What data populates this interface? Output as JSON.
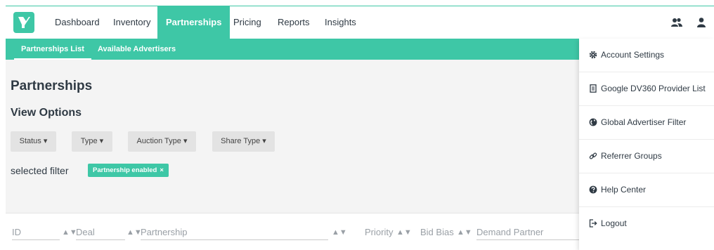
{
  "nav": {
    "items": [
      {
        "label": "Dashboard",
        "active": false
      },
      {
        "label": "Inventory",
        "active": false
      },
      {
        "label": "Partnerships",
        "active": true
      },
      {
        "label": "Pricing",
        "active": false
      },
      {
        "label": "Reports",
        "active": false
      },
      {
        "label": "Insights",
        "active": false
      }
    ],
    "icons": [
      "users-icon",
      "user-icon"
    ]
  },
  "subnav": {
    "items": [
      {
        "label": "Partnerships List",
        "active": true
      },
      {
        "label": "Available Advertisers",
        "active": false
      }
    ]
  },
  "main": {
    "title": "Partnerships",
    "view_options_title": "View Options",
    "filters": [
      "Status ▾",
      "Type ▾",
      "Auction Type ▾",
      "Share Type ▾"
    ],
    "selected_filter_label": "selected filter",
    "chip": {
      "label": "Partnership enabled",
      "close": "×"
    }
  },
  "table": {
    "columns": [
      "ID",
      "Deal",
      "Partnership",
      "Priority",
      "Bid Bias",
      "Demand Partner"
    ]
  },
  "user_menu": {
    "items": [
      {
        "label": "Account Settings",
        "icon": "gear-icon"
      },
      {
        "label": "Google DV360 Provider List",
        "icon": "document-icon"
      },
      {
        "label": "Global Advertiser Filter",
        "icon": "globe-icon"
      },
      {
        "label": "Referrer Groups",
        "icon": "link-icon"
      },
      {
        "label": "Help Center",
        "icon": "help-icon"
      },
      {
        "label": "Logout",
        "icon": "logout-icon"
      }
    ]
  },
  "colors": {
    "accent": "#3ec7a6",
    "text": "#2f3a44",
    "content_bg": "#f4f4f4"
  }
}
